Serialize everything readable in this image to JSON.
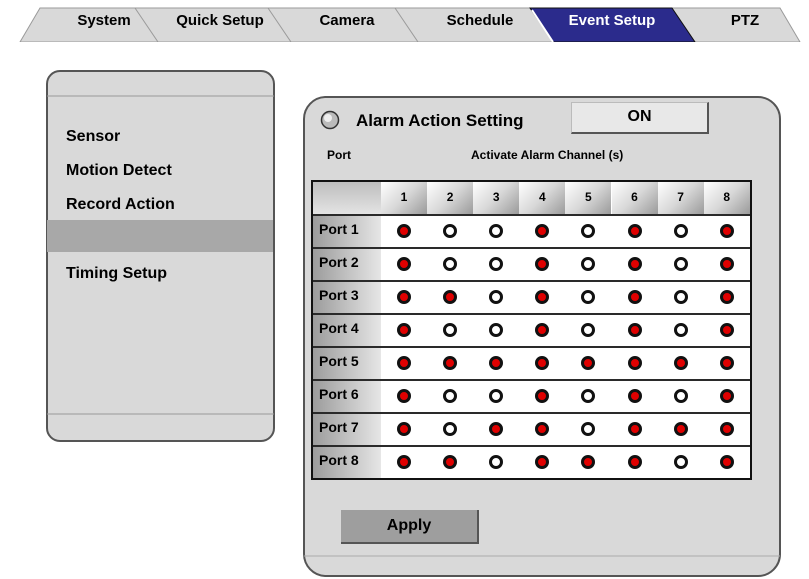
{
  "tabs": [
    {
      "label": "System",
      "active": false
    },
    {
      "label": "Quick Setup",
      "active": false
    },
    {
      "label": "Camera",
      "active": false
    },
    {
      "label": "Schedule",
      "active": false
    },
    {
      "label": "Event Setup",
      "active": true
    },
    {
      "label": "PTZ",
      "active": false
    }
  ],
  "sidebar": {
    "items": [
      {
        "label": "Sensor"
      },
      {
        "label": "Motion Detect"
      },
      {
        "label": "Record Action"
      },
      {
        "label": "",
        "selected": true
      },
      {
        "label": "Timing Setup"
      }
    ]
  },
  "panel": {
    "title": "Alarm Action Setting",
    "toggle_label": "ON",
    "port_header": "Port",
    "channel_header": "Activate Alarm Channel (s)",
    "apply_label": "Apply"
  },
  "grid": {
    "channels": [
      "1",
      "2",
      "3",
      "4",
      "5",
      "6",
      "7",
      "8"
    ],
    "ports": [
      {
        "label": "Port 1",
        "states": [
          1,
          0,
          0,
          1,
          0,
          1,
          0,
          1
        ]
      },
      {
        "label": "Port 2",
        "states": [
          1,
          0,
          0,
          1,
          0,
          1,
          0,
          1
        ]
      },
      {
        "label": "Port 3",
        "states": [
          1,
          1,
          0,
          1,
          0,
          1,
          0,
          1
        ]
      },
      {
        "label": "Port 4",
        "states": [
          1,
          0,
          0,
          1,
          0,
          1,
          0,
          1
        ]
      },
      {
        "label": "Port 5",
        "states": [
          1,
          1,
          1,
          1,
          1,
          1,
          1,
          1
        ]
      },
      {
        "label": "Port 6",
        "states": [
          1,
          0,
          0,
          1,
          0,
          1,
          0,
          1
        ]
      },
      {
        "label": "Port 7",
        "states": [
          1,
          0,
          1,
          1,
          0,
          1,
          1,
          1
        ]
      },
      {
        "label": "Port 8",
        "states": [
          1,
          1,
          0,
          1,
          1,
          1,
          0,
          1
        ]
      }
    ]
  },
  "colors": {
    "active_tab": "#2b2b8c",
    "tab_bg": "#d9d9d9",
    "panel_bg": "#d9d9d9",
    "alarm_on": "#e00000",
    "highlight": "#a8a8a8"
  }
}
